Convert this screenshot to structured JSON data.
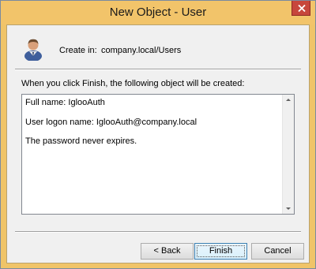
{
  "window": {
    "title": "New Object - User"
  },
  "header": {
    "icon": "user-icon",
    "create_in_label": "Create in:",
    "create_in_path": "company.local/Users"
  },
  "main": {
    "info_label": "When you click Finish, the following object will be created:",
    "summary_lines": [
      "Full name: IglooAuth",
      "User logon name: IglooAuth@company.local",
      "The password never expires."
    ]
  },
  "buttons": {
    "back": "< Back",
    "finish": "Finish",
    "cancel": "Cancel"
  },
  "colors": {
    "titlebar": "#f2c46a",
    "close_button": "#c7473c"
  }
}
